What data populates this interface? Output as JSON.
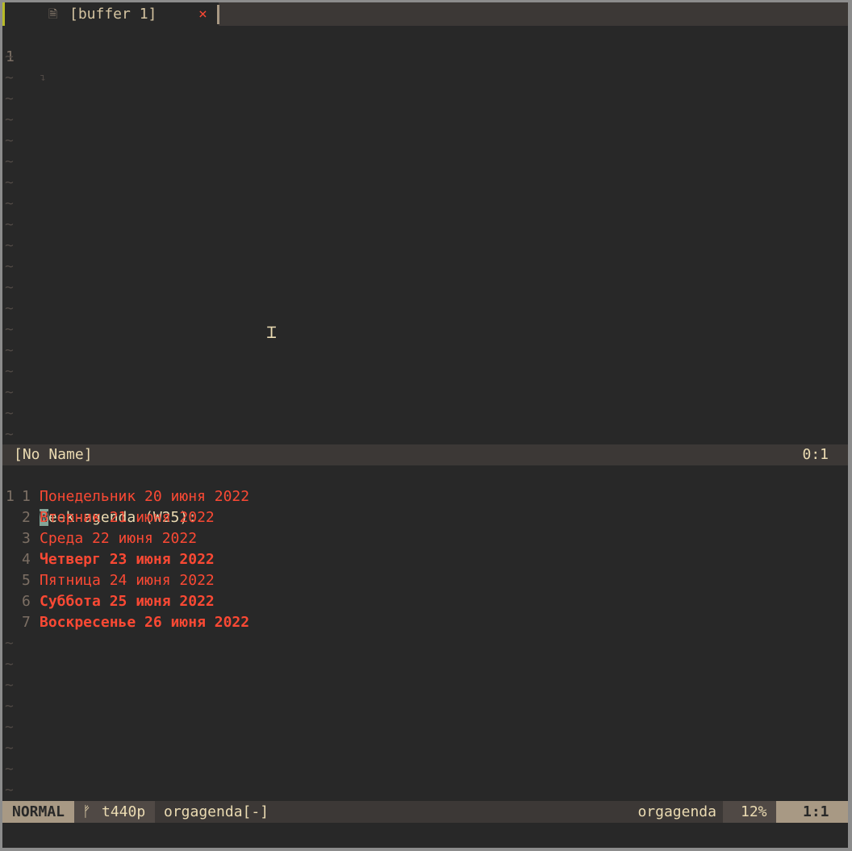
{
  "tab": {
    "title": "[buffer 1]",
    "close_glyph": "×",
    "file_icon": "file-icon"
  },
  "top_window": {
    "line_number": "1",
    "eol_glyph": "↴",
    "tilde": "~",
    "status_name": "[No Name]",
    "status_pos": "0:1"
  },
  "agenda": {
    "header_line_number": "1",
    "header": "Week-agenda (W25):",
    "days": [
      {
        "num": "1",
        "text": "Понедельник 20 июня 2022",
        "bold": false
      },
      {
        "num": "2",
        "text": "Вторник 21 июня 2022",
        "bold": false
      },
      {
        "num": "3",
        "text": "Среда 22 июня 2022",
        "bold": false
      },
      {
        "num": "4",
        "text": "Четверг 23 июня 2022",
        "bold": true
      },
      {
        "num": "5",
        "text": "Пятница 24 июня 2022",
        "bold": false
      },
      {
        "num": "6",
        "text": "Суббота 25 июня 2022",
        "bold": true
      },
      {
        "num": "7",
        "text": "Воскресенье 26 июня 2022",
        "bold": true
      }
    ]
  },
  "statusline": {
    "mode": "NORMAL",
    "branch_icon": "ᚠ",
    "branch": "t440p",
    "file": "orgagenda[-]",
    "filetype": "orgagenda",
    "percent": "12%",
    "position": "1:1"
  },
  "mouse": {
    "glyph": "Ɪ"
  },
  "colors": {
    "background": "#282828",
    "foreground": "#ebdbb2",
    "agenda_red": "#fb4934",
    "cursor": "#83a598",
    "status_accent": "#a89984",
    "tab_active_marker": "#b8bb26"
  }
}
